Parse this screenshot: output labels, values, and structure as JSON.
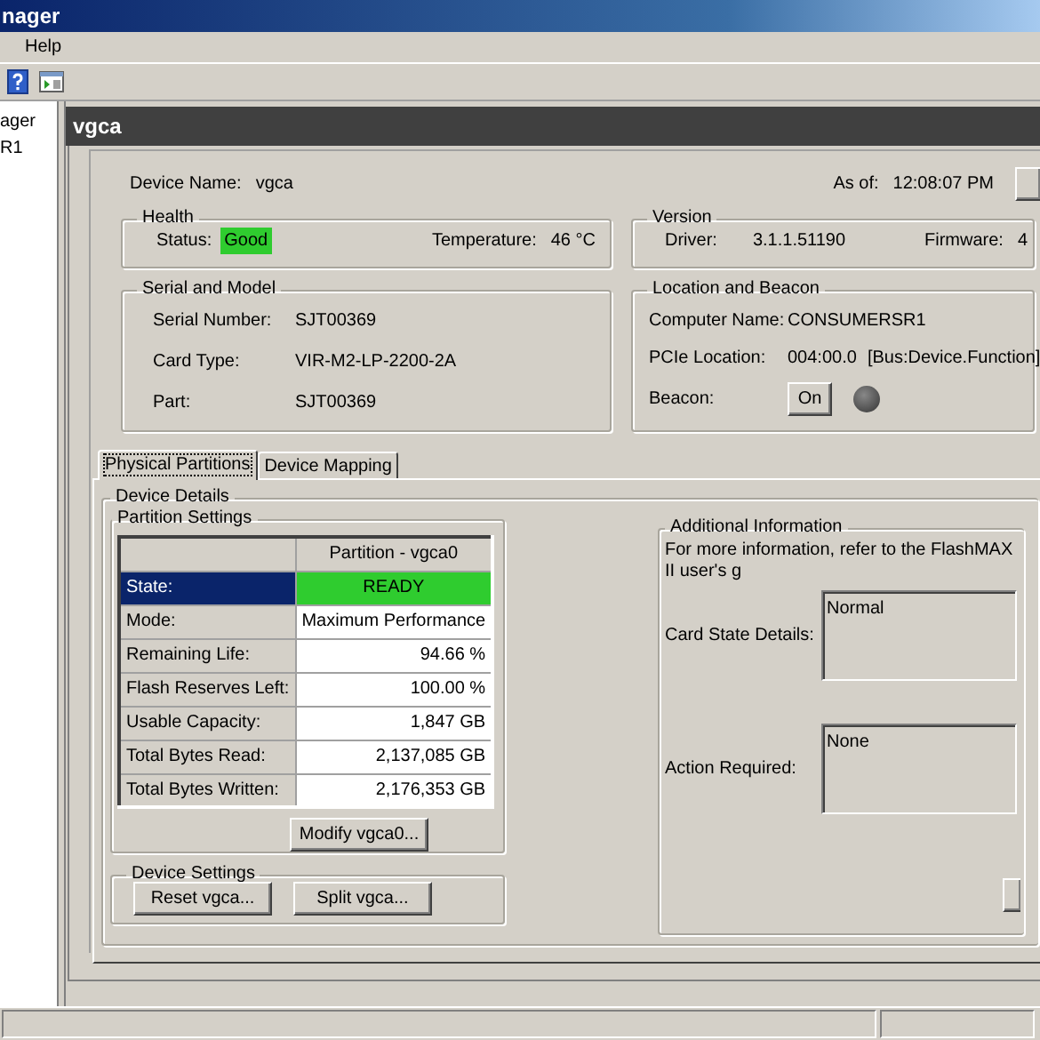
{
  "window": {
    "title": "nager"
  },
  "menu": [
    {
      "label": "Help"
    }
  ],
  "tree": {
    "items": [
      {
        "label": "ager"
      },
      {
        "label": "R1"
      }
    ]
  },
  "device": {
    "header": "vgca",
    "name_label": "Device Name:",
    "name": "vgca",
    "as_of_label": "As of:",
    "as_of": "12:08:07 PM"
  },
  "health": {
    "title": "Health",
    "status_label": "Status:",
    "status": "Good",
    "temperature_label": "Temperature:",
    "temperature": "46 °C"
  },
  "version": {
    "title": "Version",
    "driver_label": "Driver:",
    "driver": "3.1.1.51190",
    "firmware_label": "Firmware:",
    "firmware": "4"
  },
  "serial": {
    "title": "Serial and Model",
    "fields": [
      {
        "label": "Serial Number:",
        "value": "SJT00369"
      },
      {
        "label": "Card Type:",
        "value": "VIR-M2-LP-2200-2A"
      },
      {
        "label": "Part:",
        "value": "SJT00369"
      }
    ]
  },
  "location": {
    "title": "Location and Beacon",
    "computer_label": "Computer Name:",
    "computer": "CONSUMERSR1",
    "pcie_label": "PCIe Location:",
    "pcie": "004:00.0",
    "pcie_note": "[Bus:Device.Function]",
    "beacon_label": "Beacon:",
    "beacon_button": "On",
    "beacon_lit": false
  },
  "tabs": [
    {
      "label": "Physical Partitions",
      "selected": true
    },
    {
      "label": "Device Mapping",
      "selected": false
    }
  ],
  "device_details": {
    "title": "Device Details",
    "partition_settings": {
      "title": "Partition Settings",
      "column": "Partition - vgca0",
      "rows": [
        {
          "label": "State:",
          "value": "READY",
          "kind": "status",
          "selected": true
        },
        {
          "label": "Mode:",
          "value": "Maximum Performance",
          "kind": "text",
          "selected": false
        },
        {
          "label": "Remaining Life:",
          "value": "94.66  %",
          "kind": "number",
          "selected": false
        },
        {
          "label": "Flash Reserves Left:",
          "value": "100.00  %",
          "kind": "number",
          "selected": false
        },
        {
          "label": "Usable Capacity:",
          "value": "1,847 GB",
          "kind": "number",
          "selected": false
        },
        {
          "label": "Total Bytes Read:",
          "value": "2,137,085 GB",
          "kind": "number",
          "selected": false
        },
        {
          "label": "Total Bytes Written:",
          "value": "2,176,353 GB",
          "kind": "number",
          "selected": false
        }
      ],
      "modify_button": "Modify vgca0..."
    },
    "device_settings": {
      "title": "Device Settings",
      "buttons": [
        "Reset vgca...",
        "Split vgca..."
      ]
    }
  },
  "additional": {
    "title": "Additional  Information",
    "note": "For more information, refer to the FlashMAX II user's g",
    "fields": [
      {
        "label": "Card State Details:",
        "value": "Normal"
      },
      {
        "label": "Action Required:",
        "value": "None"
      }
    ]
  }
}
